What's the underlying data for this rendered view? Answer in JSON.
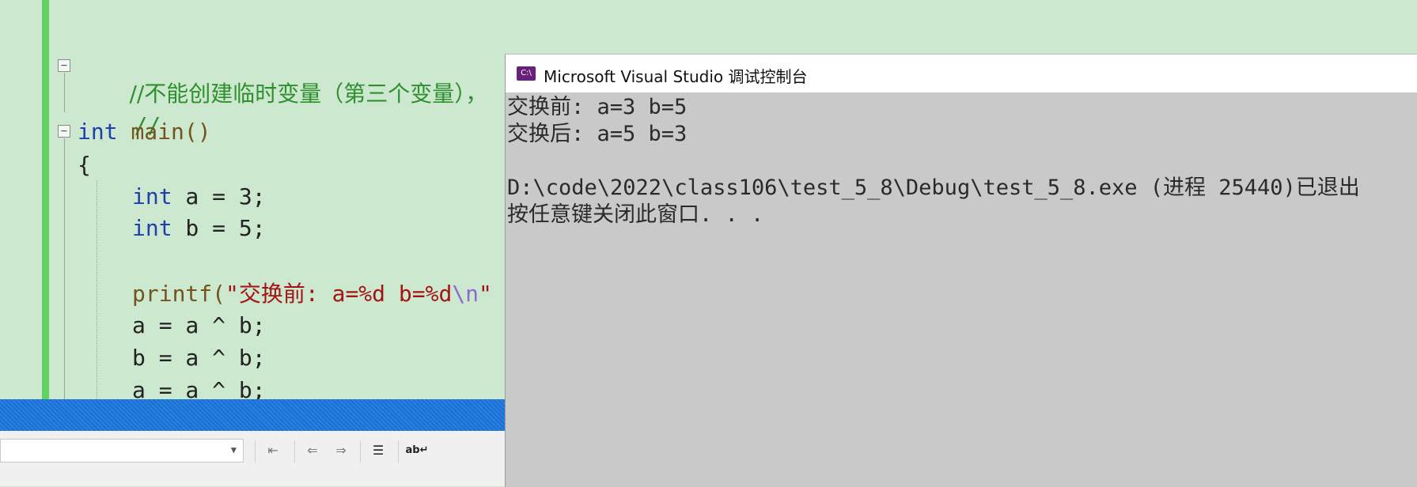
{
  "editor": {
    "comment_line": "//不能创建临时变量（第三个变量），",
    "comment_empty": "//",
    "main_kw": "int",
    "main_name": "main()",
    "brace_open": "{",
    "decl_a_kw": "int",
    "decl_a_rest": " a = 3;",
    "decl_b_kw": "int",
    "decl_b_rest": " b = 5;",
    "printf_fn": "printf(",
    "printf_str": "\"交换前: a=%d b=%d",
    "printf_esc": "\\n",
    "printf_end": "\"",
    "xor1": "a = a ^ b;",
    "xor2": "b = a ^ b;",
    "xor3": "a = a ^ b;",
    "fold_symbol": "−"
  },
  "console": {
    "title": "Microsoft Visual Studio 调试控制台",
    "icon_text": "C:\\",
    "lines": [
      "交换前: a=3 b=5",
      "交换后: a=5 b=3",
      "",
      "D:\\code\\2022\\class106\\test_5_8\\Debug\\test_5_8.exe (进程 25440)已退出",
      "按任意键关闭此窗口. . ."
    ]
  },
  "toolbar": {
    "combo_value": "",
    "icons": [
      "comment-icon",
      "outdent-icon",
      "indent-icon",
      "format-list-icon",
      "word-wrap-icon"
    ]
  },
  "colors": {
    "editor_bg": "#cce8cf",
    "keyword": "#1f3fb0",
    "string": "#a31515",
    "comment": "#2f8f2f",
    "console_bg": "#c9c9c9",
    "status_stripe": "#1a6fd4"
  }
}
